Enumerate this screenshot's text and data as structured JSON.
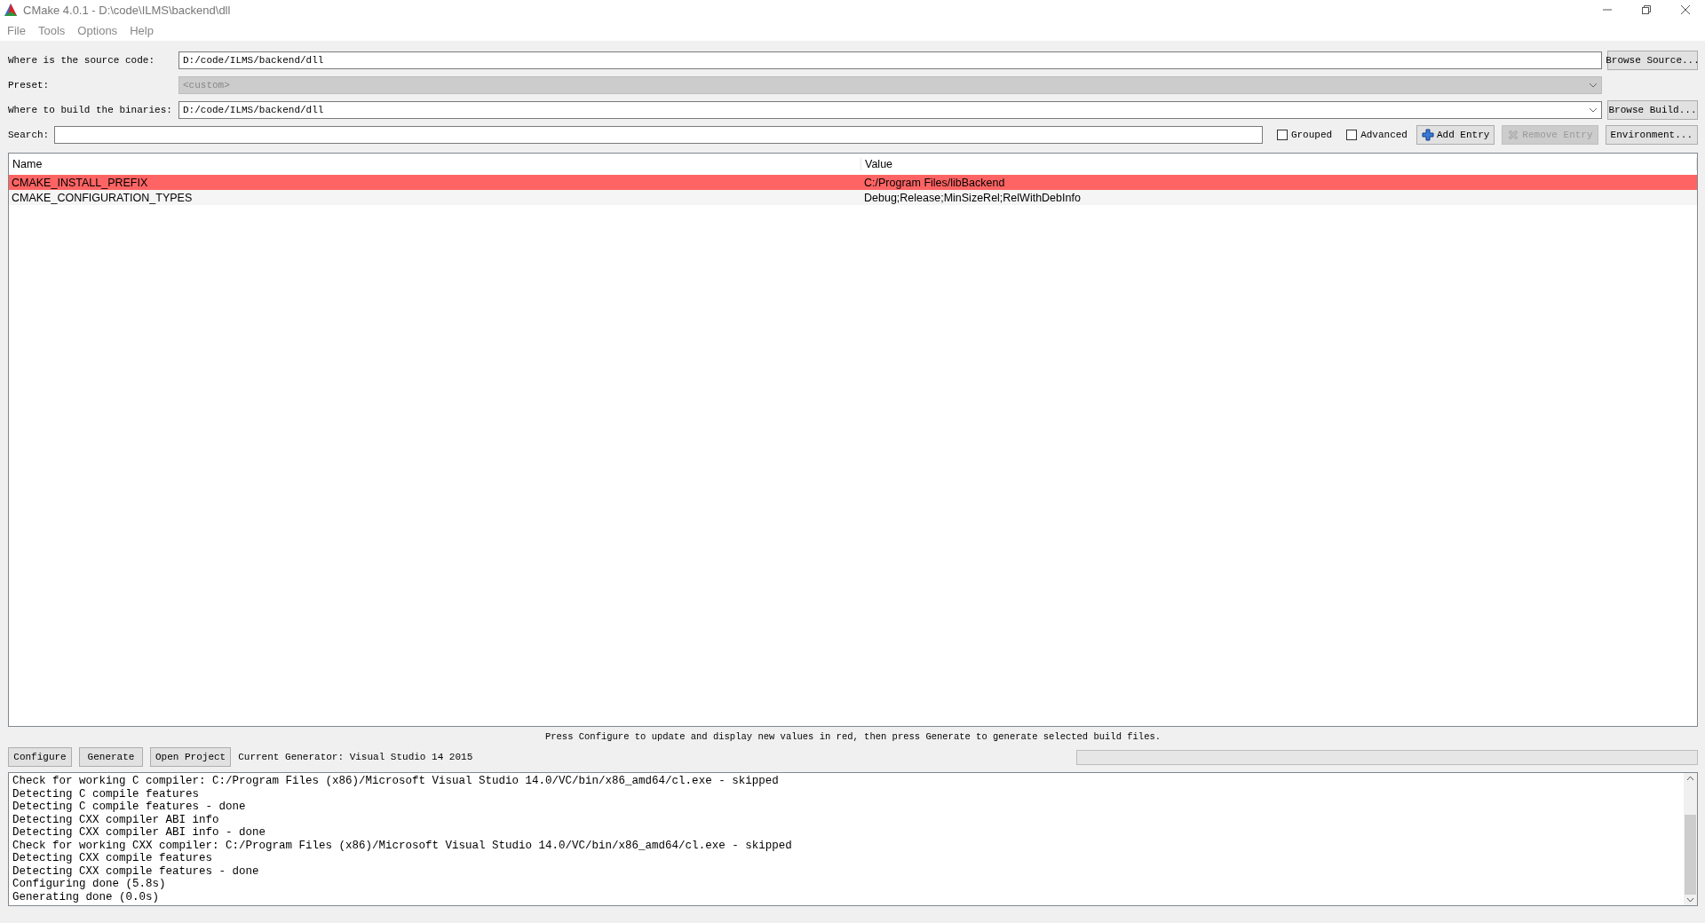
{
  "window": {
    "title": "CMake 4.0.1 - D:\\code\\ILMS\\backend\\dll"
  },
  "menu": [
    "File",
    "Tools",
    "Options",
    "Help"
  ],
  "source": {
    "label": "Where is the source code:",
    "value": "D:/code/ILMS/backend/dll",
    "button": "Browse Source..."
  },
  "preset": {
    "label": "Preset:",
    "value": "<custom>",
    "disabled": true
  },
  "build": {
    "label": "Where to build the binaries:",
    "value": "D:/code/ILMS/backend/dll",
    "button": "Browse Build..."
  },
  "search": {
    "label": "Search:"
  },
  "options": [
    {
      "label": "Grouped",
      "checked": false
    },
    {
      "label": "Advanced",
      "checked": false
    }
  ],
  "toolbar_buttons": [
    {
      "label": "Add Entry",
      "kind": "add",
      "disabled": false
    },
    {
      "label": "Remove Entry",
      "kind": "remove",
      "disabled": true
    },
    {
      "label": "Environment...",
      "kind": "plain",
      "disabled": false
    }
  ],
  "table": {
    "columns": [
      "Name",
      "Value"
    ],
    "rows": [
      {
        "name": "CMAKE_INSTALL_PREFIX",
        "value": "C:/Program Files/libBackend",
        "new": true
      },
      {
        "name": "CMAKE_CONFIGURATION_TYPES",
        "value": "Debug;Release;MinSizeRel;RelWithDebInfo",
        "new": false
      }
    ]
  },
  "hint": "Press Configure to update and display new values in red, then press Generate to generate selected build files.",
  "actions": [
    "Configure",
    "Generate",
    "Open Project"
  ],
  "generator": "Current Generator: Visual Studio 14 2015",
  "progress": {
    "level": 0
  },
  "log": [
    "Check for working C compiler: C:/Program Files (x86)/Microsoft Visual Studio 14.0/VC/bin/x86_amd64/cl.exe - skipped",
    "Detecting C compile features",
    "Detecting C compile features - done",
    "Detecting CXX compiler ABI info",
    "Detecting CXX compiler ABI info - done",
    "Check for working CXX compiler: C:/Program Files (x86)/Microsoft Visual Studio 14.0/VC/bin/x86_amd64/cl.exe - skipped",
    "Detecting CXX compile features",
    "Detecting CXX compile features - done",
    "Configuring done (5.8s)",
    "Generating done (0.0s)"
  ]
}
